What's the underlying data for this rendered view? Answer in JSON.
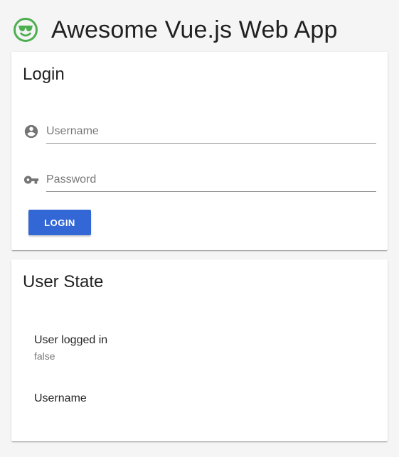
{
  "header": {
    "title": "Awesome Vue.js Web App",
    "logo_icon": "sunglasses-smiley-icon",
    "logo_color": "#4caf50"
  },
  "login_card": {
    "title": "Login",
    "username": {
      "icon": "account-circle-icon",
      "placeholder": "Username",
      "value": ""
    },
    "password": {
      "icon": "key-icon",
      "placeholder": "Password",
      "value": ""
    },
    "login_button_label": "LOGIN",
    "button_color": "#3367d6"
  },
  "state_card": {
    "title": "User State",
    "logged_in_label": "User logged in",
    "logged_in_value": "false",
    "username_label": "Username",
    "username_value": ""
  }
}
